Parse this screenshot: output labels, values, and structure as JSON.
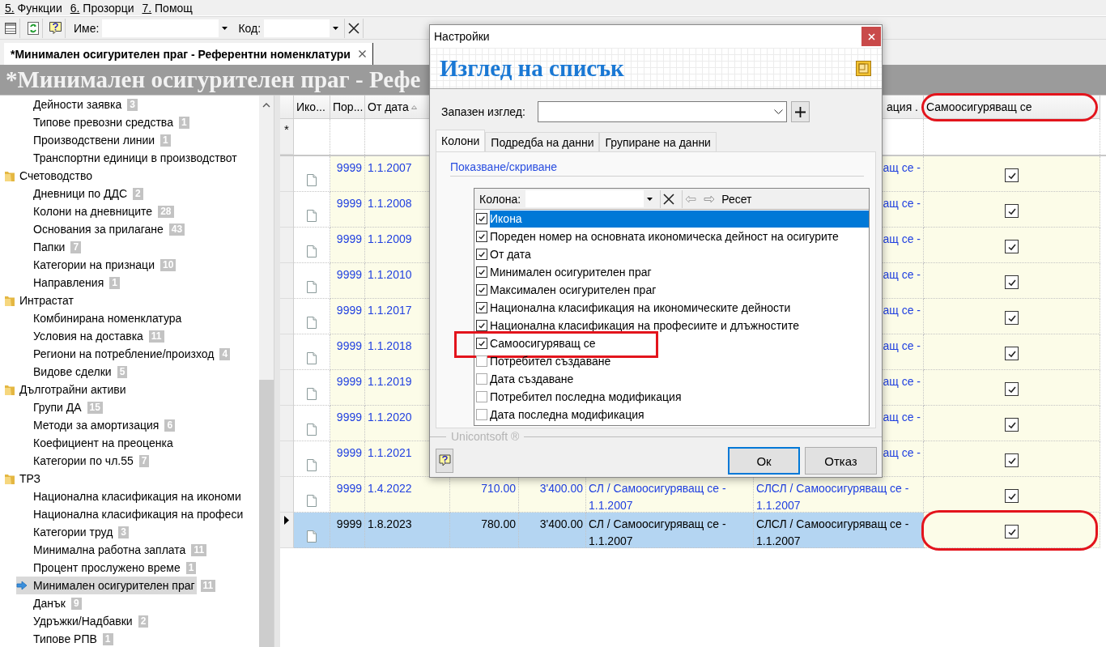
{
  "menu": [
    {
      "label": "5. Функции"
    },
    {
      "label": "6. Прозорци"
    },
    {
      "label": "7. Помощ"
    }
  ],
  "toolbar": {
    "fields": [
      {
        "label": "Име:"
      },
      {
        "label": "Код:"
      }
    ]
  },
  "document_tab": {
    "label": "*Минимален осигурителен праг - Референтни номенклатури"
  },
  "page_title": "*Минимален осигурителен праг - Рефе",
  "tree": [
    {
      "children": [
        {
          "label": "Дейности заявка",
          "count": "3",
          "selected": false
        },
        {
          "label": "Типове превозни средства",
          "count": "1",
          "selected": false
        },
        {
          "label": "Производствени линии",
          "count": "1",
          "selected": false
        },
        {
          "label": "Транспортни единици в производствот",
          "selected": false
        }
      ]
    },
    {
      "label": "Счетоводство",
      "children": [
        {
          "label": "Дневници по ДДС",
          "count": "2",
          "selected": false
        },
        {
          "label": "Колони на дневниците",
          "count": "28",
          "selected": false
        },
        {
          "label": "Основания за прилагане",
          "count": "43",
          "selected": false
        },
        {
          "label": "Папки",
          "count": "7",
          "selected": false
        },
        {
          "label": "Категории на признаци",
          "count": "10",
          "selected": false
        },
        {
          "label": "Направления",
          "count": "1",
          "selected": false
        }
      ]
    },
    {
      "label": "Интрастат",
      "children": [
        {
          "label": "Комбинирана номенклатура",
          "selected": false
        },
        {
          "label": "Условия на доставка",
          "count": "11",
          "selected": false
        },
        {
          "label": "Региони на потребление/произход",
          "count": "4",
          "selected": false
        },
        {
          "label": "Видове сделки",
          "count": "5",
          "selected": false
        }
      ]
    },
    {
      "label": "Дълготрайни активи",
      "children": [
        {
          "label": "Групи ДА",
          "count": "15",
          "selected": false
        },
        {
          "label": "Методи за амортизация",
          "count": "6",
          "selected": false
        },
        {
          "label": "Коефициент на преоценка",
          "selected": false
        },
        {
          "label": "Категории по чл.55",
          "count": "7",
          "selected": false
        }
      ]
    },
    {
      "label": "ТРЗ",
      "children": [
        {
          "label": "Национална класификация на икономи",
          "selected": false
        },
        {
          "label": "Национална класификация на професи",
          "selected": false
        },
        {
          "label": "Категории труд",
          "count": "3",
          "selected": false
        },
        {
          "label": "Минимална работна заплата",
          "count": "11",
          "selected": false
        },
        {
          "label": "Процент прослужено време",
          "count": "1",
          "selected": false
        },
        {
          "label": "Минимален осигурителен праг",
          "count": "11",
          "selected": true
        },
        {
          "label": "Данък",
          "count": "9",
          "selected": false
        },
        {
          "label": "Удръжки/Надбавки",
          "count": "2",
          "selected": false
        },
        {
          "label": "Типове РПВ",
          "count": "1",
          "selected": false
        }
      ]
    }
  ],
  "grid": {
    "columns": [
      {
        "kind": "icon",
        "label": "Ико..."
      },
      {
        "kind": "number",
        "label": "Пор..."
      },
      {
        "kind": "date",
        "label": "От дата",
        "sorted": true
      },
      {
        "kind": "min"
      },
      {
        "kind": "max"
      },
      {
        "kind": "nkid"
      },
      {
        "kind": "nkpd",
        "label": "ация .",
        "covered": true
      },
      {
        "kind": "self_insured",
        "label": "Самоосигуряващ се",
        "circled": true
      }
    ],
    "new_row_marker": "*",
    "rows": [
      {
        "number": "9999",
        "date": "1.1.2007",
        "nkpd": "ащ се -",
        "self_insured": true,
        "covered": true,
        "selected": false
      },
      {
        "number": "9999",
        "date": "1.1.2008",
        "nkpd": "ащ се -",
        "self_insured": true,
        "covered": true,
        "selected": false
      },
      {
        "number": "9999",
        "date": "1.1.2009",
        "nkpd": "ащ се -",
        "self_insured": true,
        "covered": true,
        "selected": false
      },
      {
        "number": "9999",
        "date": "1.1.2010",
        "nkpd": "ащ се -",
        "self_insured": true,
        "covered": true,
        "selected": false
      },
      {
        "number": "9999",
        "date": "1.1.2017",
        "nkpd": "ащ се -",
        "self_insured": true,
        "covered": true,
        "selected": false
      },
      {
        "number": "9999",
        "date": "1.1.2018",
        "nkpd": "ащ се -",
        "self_insured": true,
        "covered": true,
        "selected": false
      },
      {
        "number": "9999",
        "date": "1.1.2019",
        "nkpd": "ащ се -",
        "self_insured": true,
        "covered": true,
        "selected": false
      },
      {
        "number": "9999",
        "date": "1.1.2020",
        "nkpd": "ащ се -",
        "self_insured": true,
        "covered": true,
        "selected": false
      },
      {
        "number": "9999",
        "date": "1.1.2021",
        "nkpd": "ащ се -",
        "self_insured": true,
        "covered": true,
        "selected": false
      },
      {
        "number": "9999",
        "date": "1.4.2022",
        "min": "710.00",
        "max": "3'400.00",
        "nkid": "СЛ / Самоосигуряващ се - 1.1.2007",
        "nkpd": "СЛСЛ / Самоосигуряващ се - 1.1.2007",
        "self_insured": true,
        "covered": false,
        "selected": false
      },
      {
        "number": "9999",
        "date": "1.8.2023",
        "min": "780.00",
        "max": "3'400.00",
        "nkid": "СЛ / Самоосигуряващ се - 1.1.2007",
        "nkpd": "СЛСЛ / Самоосигуряващ се - 1.1.2007",
        "self_insured": true,
        "covered": false,
        "selected": true,
        "circled": true
      }
    ]
  },
  "dialog": {
    "title": "Настройки",
    "heading": "Изглед на списък",
    "saved_view": {
      "label": "Запазен изглед:"
    },
    "tabs": [
      {
        "label": "Колони",
        "selected": true
      },
      {
        "label": "Подредба на данни",
        "selected": false
      },
      {
        "label": "Групиране на данни",
        "selected": false
      }
    ],
    "group": "Показване/скриване",
    "column_filter": {
      "label": "Колона:"
    },
    "reset": "Ресет",
    "columns": [
      {
        "label": "Икона",
        "checked": true,
        "selected": true,
        "marked": false
      },
      {
        "label": "Пореден номер на основната икономическа дейност на осигурите",
        "checked": true,
        "selected": false,
        "marked": false
      },
      {
        "label": "От дата",
        "checked": true,
        "selected": false,
        "marked": false
      },
      {
        "label": "Минимален осигурителен праг",
        "checked": true,
        "selected": false,
        "marked": false
      },
      {
        "label": "Максимален осигурителен праг",
        "checked": true,
        "selected": false,
        "marked": false
      },
      {
        "label": "Национална класификация на икономическите дейности",
        "checked": true,
        "selected": false,
        "marked": false
      },
      {
        "label": "Национална класификация на професиите и длъжностите",
        "checked": true,
        "selected": false,
        "marked": false
      },
      {
        "label": "Самоосигуряващ се",
        "checked": true,
        "selected": false,
        "marked": true
      },
      {
        "label": "Потребител създаване",
        "checked": false,
        "selected": false,
        "marked": false
      },
      {
        "label": "Дата създаване",
        "checked": false,
        "selected": false,
        "marked": false
      },
      {
        "label": "Потребител последна модификация",
        "checked": false,
        "selected": false,
        "marked": false
      },
      {
        "label": "Дата последна модификация",
        "checked": false,
        "selected": false,
        "marked": false
      }
    ],
    "brand": "Unicontsoft ®",
    "buttons": [
      {
        "label": "Ок",
        "default": true
      },
      {
        "label": "Отказ",
        "default": false
      }
    ]
  }
}
